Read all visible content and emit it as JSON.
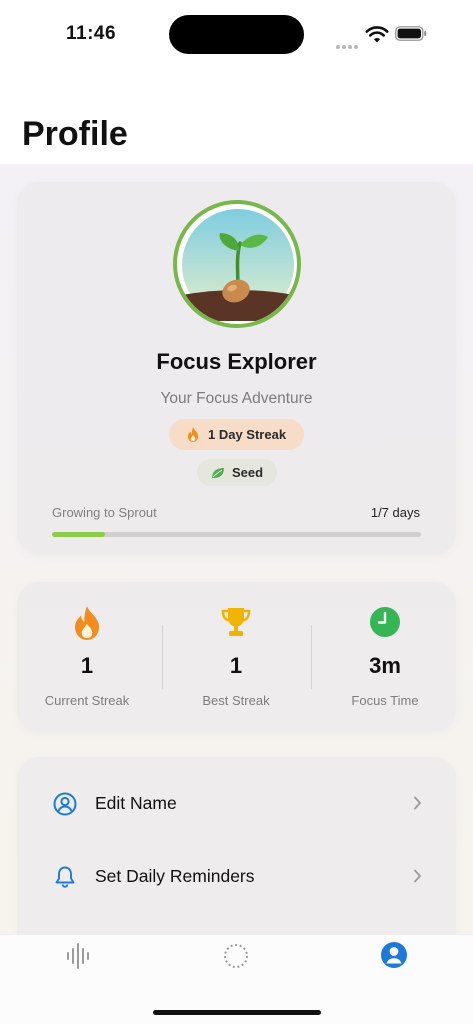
{
  "status_bar": {
    "time": "11:46"
  },
  "header": {
    "title": "Profile"
  },
  "profile": {
    "name": "Focus Explorer",
    "subtitle": "Your Focus Adventure",
    "streak_badge": "1 Day Streak",
    "level_badge": "Seed",
    "progress_label": "Growing to Sprout",
    "progress_value": "1/7 days",
    "progress_fraction": 0.143
  },
  "stats": [
    {
      "value": "1",
      "label": "Current Streak",
      "icon": "flame-icon"
    },
    {
      "value": "1",
      "label": "Best Streak",
      "icon": "trophy-icon"
    },
    {
      "value": "3m",
      "label": "Focus Time",
      "icon": "clock-icon"
    }
  ],
  "menu": [
    {
      "label": "Edit Name",
      "icon": "person-circle-icon"
    },
    {
      "label": "Set Daily Reminders",
      "icon": "bell-icon"
    }
  ],
  "tab_bar": {
    "tabs": [
      {
        "name": "sound",
        "icon": "waveform-icon",
        "active": false
      },
      {
        "name": "focus",
        "icon": "dotted-circle-icon",
        "active": false
      },
      {
        "name": "profile",
        "icon": "person-icon",
        "active": true
      }
    ]
  },
  "colors": {
    "accent_blue": "#1e7ad9",
    "progress_green": "#8ccc48",
    "avatar_ring": "#78b74a",
    "streak_badge_bg": "#f7dcc7",
    "flame_orange": "#f28c1c",
    "trophy_gold": "#f0b400",
    "clock_green": "#35b554"
  }
}
